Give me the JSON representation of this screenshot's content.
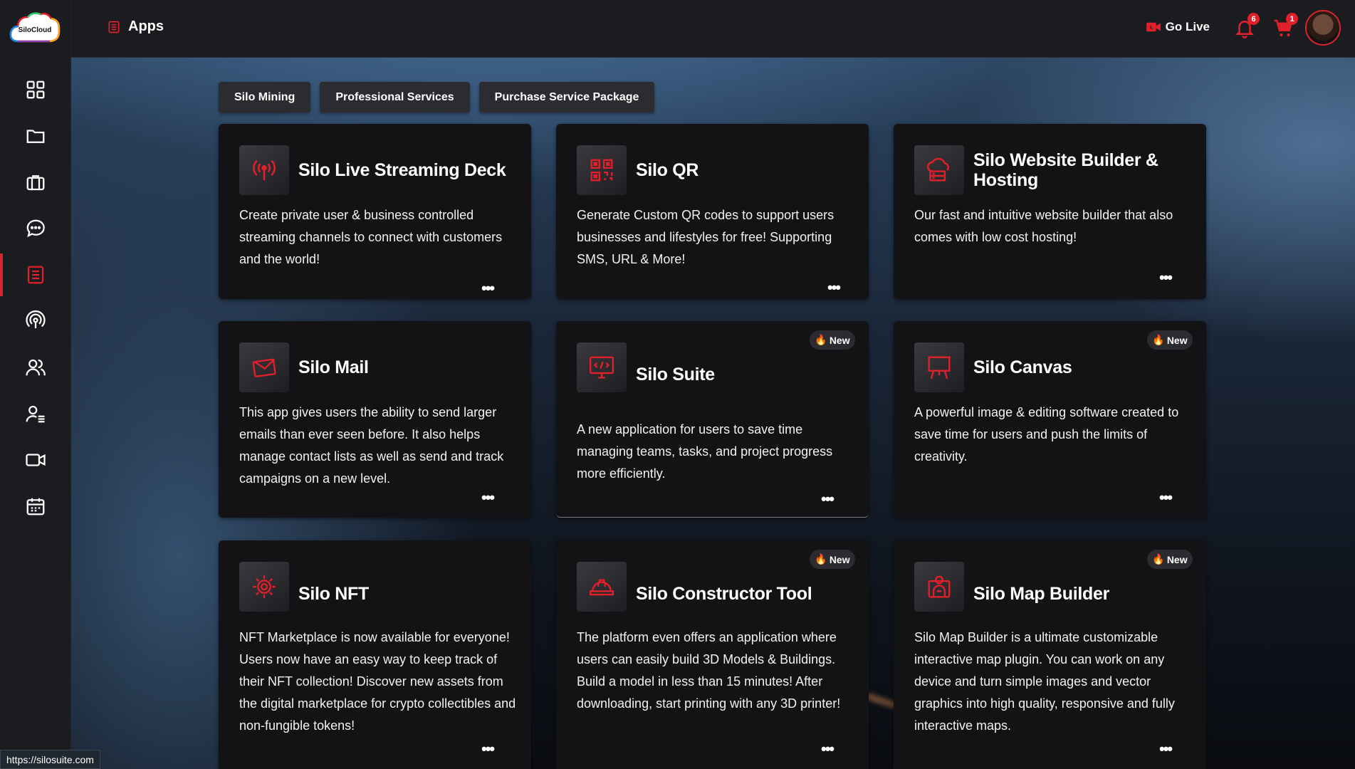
{
  "app": {
    "logo_text": "SiloCloud"
  },
  "header": {
    "title": "Apps",
    "go_live": "Go Live",
    "notifications_count": "6",
    "cart_count": "1"
  },
  "tabs": [
    "Silo Mining",
    "Professional Services",
    "Purchase Service Package"
  ],
  "cards": [
    {
      "title": "Silo Live Streaming Deck",
      "desc": "Create private user & business controlled streaming channels to connect with customers and the world!",
      "icon": "broadcast-icon"
    },
    {
      "title": "Silo QR",
      "desc": "Generate Custom QR codes to support users businesses and lifestyles for free! Supporting SMS, URL & More!",
      "icon": "qr-code-icon"
    },
    {
      "title": "Silo Website Builder & Hosting",
      "desc": "Our fast and intuitive website builder that also comes with low cost hosting!",
      "icon": "cloud-server-icon"
    },
    {
      "title": "Silo Mail",
      "desc": "This app gives users the ability to send larger emails than ever seen before. It also helps manage contact lists as well as send and track campaigns on a new level.",
      "icon": "mail-icon"
    },
    {
      "title": "Silo Suite",
      "desc": "A new application for users to save time managing teams, tasks, and project progress more efficiently.",
      "icon": "monitor-code-icon",
      "badge": "New"
    },
    {
      "title": "Silo Canvas",
      "desc": "A powerful image & editing software created to save time for users and push the limits of creativity.",
      "icon": "easel-icon",
      "badge": "New"
    },
    {
      "title": "Silo NFT",
      "desc": "NFT Marketplace is now available for everyone! Users now have an easy way to keep track of their NFT collection! Discover new assets from the digital marketplace for crypto collectibles and non-fungible tokens!",
      "icon": "gear-chip-icon"
    },
    {
      "title": "Silo Constructor Tool",
      "desc": "The platform even offers an application where users can easily build 3D Models & Buildings. Build a model in less than 15 minutes! After downloading, start printing with any 3D printer!",
      "icon": "hardhat-icon",
      "badge": "New"
    },
    {
      "title": "Silo Map Builder",
      "desc": "Silo Map Builder is a ultimate customizable interactive map plugin. You can work on any device and turn simple images and vector graphics into high quality, responsive and fully interactive maps.",
      "icon": "map-person-icon",
      "badge": "New"
    }
  ],
  "more_label": "•••",
  "status_url": "https://silosuite.com",
  "colors": {
    "accent": "#d9232e",
    "sidebar": "#1b1c20",
    "card": "#131316"
  }
}
